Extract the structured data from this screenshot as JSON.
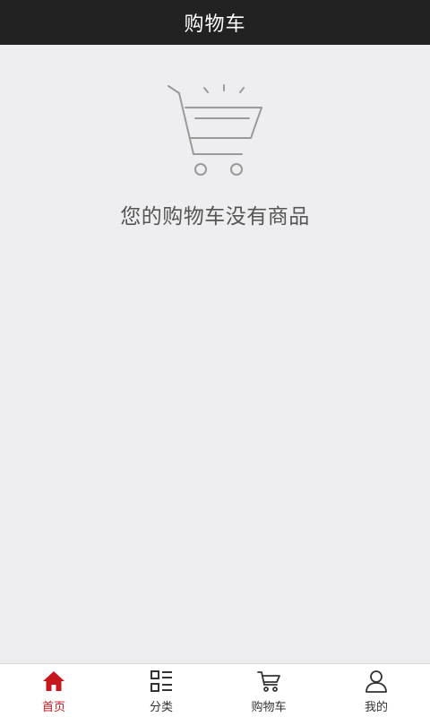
{
  "header": {
    "title": "购物车"
  },
  "main": {
    "empty_icon": "empty-cart-icon",
    "empty_message": "您的购物车没有商品"
  },
  "tabbar": {
    "active_color": "#c8161d",
    "items": [
      {
        "label": "首页",
        "icon": "home-icon",
        "active": true
      },
      {
        "label": "分类",
        "icon": "category-list-icon",
        "active": false
      },
      {
        "label": "购物车",
        "icon": "cart-icon",
        "active": false
      },
      {
        "label": "我的",
        "icon": "user-icon",
        "active": false
      }
    ]
  }
}
